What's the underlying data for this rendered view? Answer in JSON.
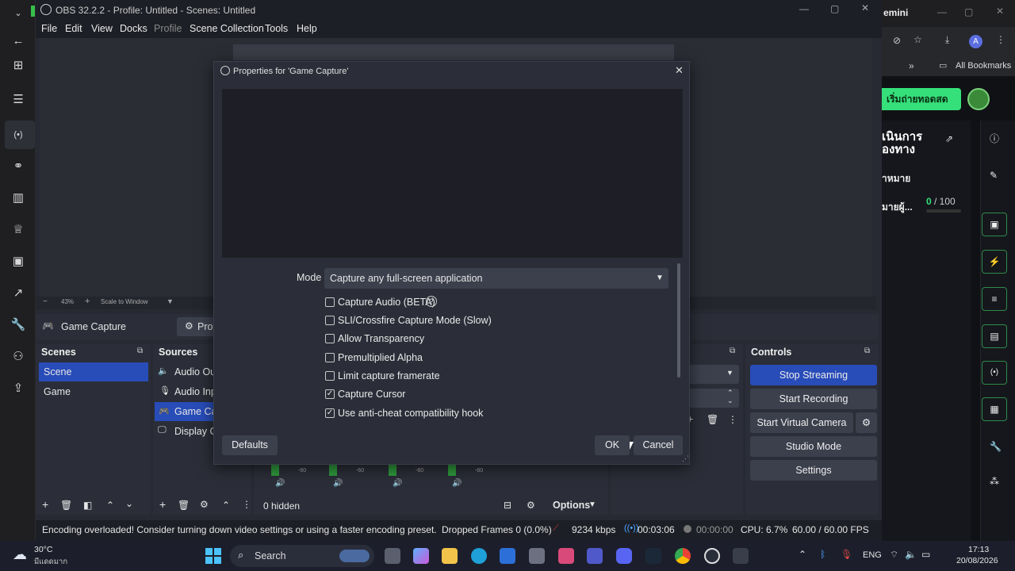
{
  "obs": {
    "title": "OBS 32.2.2 - Profile: Untitled - Scenes: Untitled",
    "menu": [
      "File",
      "Edit",
      "View",
      "Docks",
      "Profile",
      "Scene Collection",
      "Tools",
      "Help"
    ],
    "zoom": "43%",
    "scale_mode": "Scale to Window",
    "source_toolbar": {
      "name": "Game Capture",
      "props_label": "Prop"
    },
    "scenes": {
      "title": "Scenes",
      "items": [
        "Scene",
        "Game"
      ]
    },
    "sources": {
      "title": "Sources",
      "items": [
        "Audio Out",
        "Audio Inp",
        "Game Cap",
        "Display Ca"
      ]
    },
    "mixer": {
      "hidden": "0 hidden",
      "options": "Options",
      "db": "-60"
    },
    "controls": {
      "title": "Controls",
      "stop_streaming": "Stop Streaming",
      "start_recording": "Start Recording",
      "start_virtual_camera": "Start Virtual Camera",
      "studio_mode": "Studio Mode",
      "settings": "Settings"
    },
    "status": {
      "message": "Encoding overloaded! Consider turning down video settings or using a faster encoding preset.",
      "dropped": "Dropped Frames 0 (0.0%)",
      "bitrate": "9234 kbps",
      "stream_time": "00:03:06",
      "rec_time": "00:00:00",
      "cpu": "CPU: 6.7%",
      "fps": "60.00 / 60.00 FPS"
    }
  },
  "dialog": {
    "title": "Properties for 'Game Capture'",
    "mode_label": "Mode",
    "mode_value": "Capture any full-screen application",
    "options": [
      {
        "label": "Capture Audio (BETA)",
        "checked": false
      },
      {
        "label": "SLI/Crossfire Capture Mode (Slow)",
        "checked": false
      },
      {
        "label": "Allow Transparency",
        "checked": false
      },
      {
        "label": "Premultiplied Alpha",
        "checked": false
      },
      {
        "label": "Limit capture framerate",
        "checked": false
      },
      {
        "label": "Capture Cursor",
        "checked": true
      },
      {
        "label": "Use anti-cheat compatibility hook",
        "checked": true
      }
    ],
    "defaults": "Defaults",
    "ok": "OK",
    "cancel": "Cancel"
  },
  "browser": {
    "tab_title": "emini",
    "bookmarks": "All Bookmarks",
    "profile_initial": "A",
    "thai_button": "เริ่มถ่ายทอดสด",
    "heading_line1": "เนินการ",
    "heading_line2": "องทาง",
    "subtitle": "าหมาย",
    "goal_label": "มายผู้...",
    "goal_current": "0",
    "goal_total": "/ 100"
  },
  "taskbar": {
    "weather_temp": "30°C",
    "weather_text": "มีแดดมาก",
    "search": "Search",
    "lang": "ENG",
    "time": "17:13",
    "date": "20/08/2026"
  }
}
